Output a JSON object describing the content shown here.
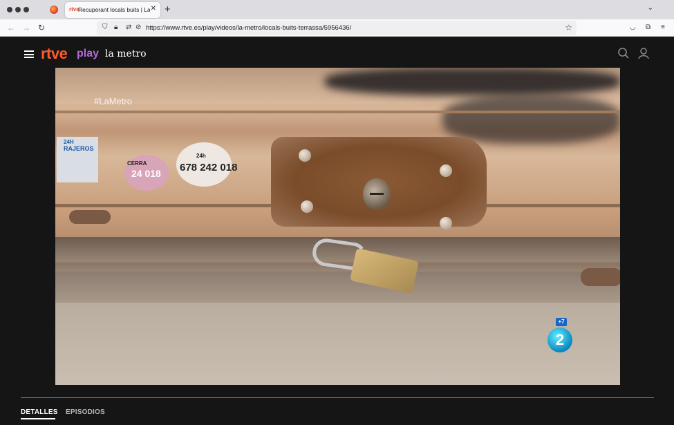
{
  "browser": {
    "tab_title": "Recuperant locals buits | La Me",
    "tab_favicon": "rtve",
    "new_tab_icon": "+",
    "url": "https://www.rtve.es/play/videos/la-metro/locals-buits-terrassa/5956436/"
  },
  "site": {
    "logo_main": "rtve",
    "logo_sub": "play",
    "program_title": "la metro",
    "brand_color": "#ff5a2a",
    "play_color": "#b06cd8"
  },
  "video": {
    "watermark": "#LaMetro",
    "channel_number": "2",
    "channel_plus": "+7",
    "stickers": [
      {
        "text": "678 242 018"
      },
      {
        "text": "24h"
      },
      {
        "text": "CERRA"
      },
      {
        "text": "24 018"
      },
      {
        "text": "24H"
      },
      {
        "text": "RAJEROS"
      }
    ]
  },
  "tabs": [
    {
      "label": "DETALLES",
      "active": true
    },
    {
      "label": "EPISODIOS",
      "active": false
    }
  ]
}
